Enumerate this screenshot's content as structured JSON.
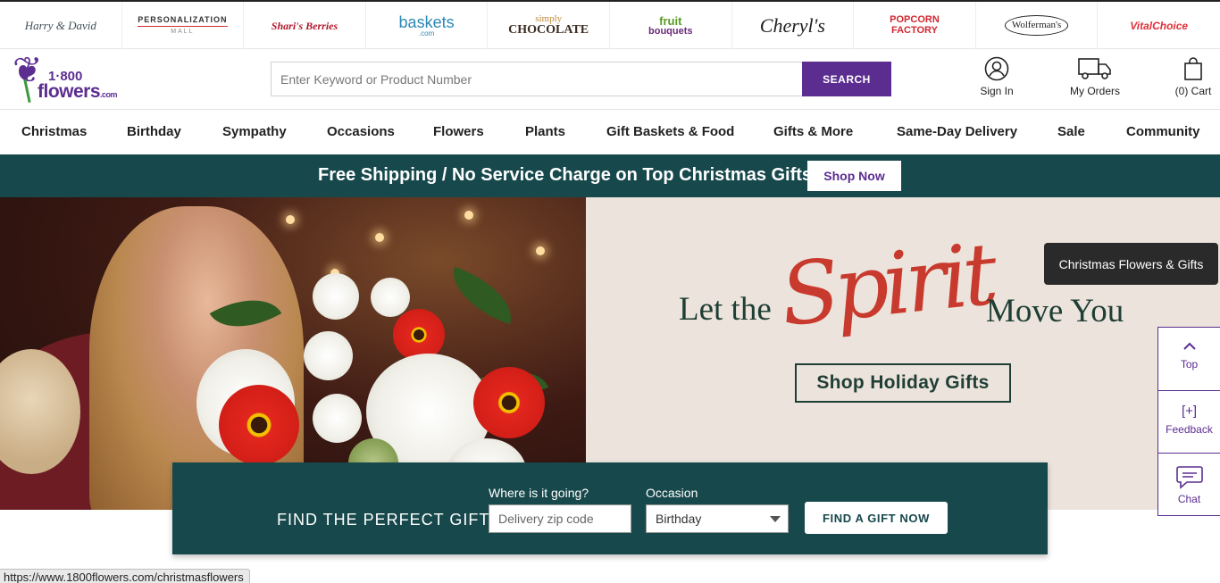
{
  "brands": [
    {
      "name": "Harry & David"
    },
    {
      "name": "PERSONALIZATION",
      "sub": "MALL"
    },
    {
      "name": "Shari's Berries"
    },
    {
      "name": "baskets",
      "sub": ".com"
    },
    {
      "name": "simply",
      "sub": "CHOCOLATE"
    },
    {
      "name": "fruit",
      "sub": "bouquets"
    },
    {
      "name": "Cheryl's"
    },
    {
      "name": "POPCORN",
      "sub": "FACTORY"
    },
    {
      "name": "Wolferman's"
    },
    {
      "name": "VitalChoice"
    }
  ],
  "header": {
    "logo_num": "1·800",
    "logo_word": "flowers",
    "logo_suffix": ".com",
    "search_placeholder": "Enter Keyword or Product Number",
    "search_button": "SEARCH",
    "sign_in": "Sign In",
    "my_orders": "My Orders",
    "cart": "(0) Cart"
  },
  "nav": [
    "Christmas",
    "Birthday",
    "Sympathy",
    "Occasions",
    "Flowers",
    "Plants",
    "Gift Baskets & Food",
    "Gifts & More",
    "Same-Day Delivery",
    "Sale",
    "Community"
  ],
  "promo": {
    "text": "Free Shipping / No Service Charge on Top Christmas Gifts",
    "button": "Shop Now"
  },
  "hero": {
    "let_the": "Let the",
    "spirit": "Spirit",
    "move_you": "Move You",
    "cta": "Shop Holiday Gifts",
    "tooltip": "Christmas Flowers & Gifts"
  },
  "finder": {
    "title": "FIND THE PERFECT GIFT",
    "zip_label": "Where is it going?",
    "zip_placeholder": "Delivery zip code",
    "occasion_label": "Occasion",
    "occasion_value": "Birthday",
    "button": "FIND A GIFT NOW"
  },
  "rail": {
    "top": "Top",
    "feedback": "Feedback",
    "feedback_glyph": "[+]",
    "chat": "Chat"
  },
  "status_url": "https://www.1800flowers.com/christmasflowers",
  "colors": {
    "brand_purple": "#5b2d91",
    "teal": "#17484c",
    "hero_bg": "#ece4dc",
    "spirit_red": "#c93a2e"
  }
}
